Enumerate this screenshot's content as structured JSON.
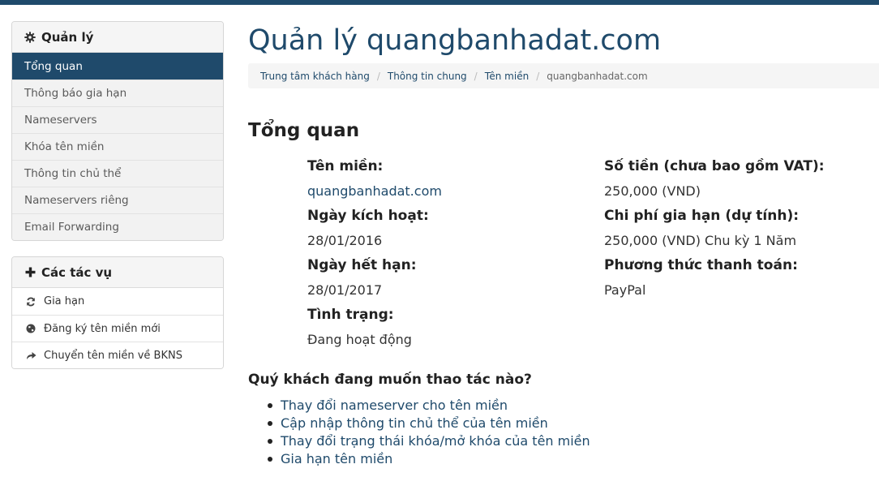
{
  "page": {
    "title": "Quản lý quangbanhadat.com"
  },
  "breadcrumb": [
    "Trung tâm khách hàng",
    "Thông tin chung",
    "Tên miền",
    "quangbanhadat.com"
  ],
  "sidebar": {
    "manage": {
      "title": "Quản lý",
      "icon": "gear-icon",
      "items": [
        {
          "label": "Tổng quan",
          "active": true
        },
        {
          "label": "Thông báo gia hạn"
        },
        {
          "label": "Nameservers"
        },
        {
          "label": "Khóa tên miền"
        },
        {
          "label": "Thông tin chủ thể"
        },
        {
          "label": "Nameservers riêng"
        },
        {
          "label": "Email Forwarding"
        }
      ]
    },
    "tasks": {
      "title": "Các tác vụ",
      "icon": "plus-icon",
      "items": [
        {
          "label": "Gia hạn",
          "icon": "refresh-icon"
        },
        {
          "label": "Đăng ký tên miền mới",
          "icon": "globe-icon"
        },
        {
          "label": "Chuyển tên miền về BKNS",
          "icon": "share-arrow-icon"
        }
      ]
    }
  },
  "overview": {
    "heading": "Tổng quan",
    "left": [
      {
        "label": "Tên miền:",
        "value": "quangbanhadat.com"
      },
      {
        "label": "Ngày kích hoạt:",
        "value": "28/01/2016"
      },
      {
        "label": "Ngày hết hạn:",
        "value": "28/01/2017"
      },
      {
        "label": "Tình trạng:",
        "value": "Đang hoạt động"
      }
    ],
    "right": [
      {
        "label": "Số tiền (chưa bao gồm VAT):",
        "value": "250,000 (VND)"
      },
      {
        "label": "Chi phí gia hạn (dự tính):",
        "value": "250,000 (VND) Chu kỳ 1 Năm"
      },
      {
        "label": "Phương thức thanh toán:",
        "value": "PayPal"
      }
    ]
  },
  "quick_actions": {
    "question": "Quý khách đang muốn thao tác nào?",
    "items": [
      "Thay đổi nameserver cho tên miền",
      "Cập nhập thông tin chủ thể của tên miền",
      "Thay đổi trạng thái khóa/mở khóa của tên miền",
      "Gia hạn tên miền"
    ]
  },
  "colors": {
    "brand": "#1f4a6b",
    "sidebar_bg": "#f2f2f2"
  }
}
